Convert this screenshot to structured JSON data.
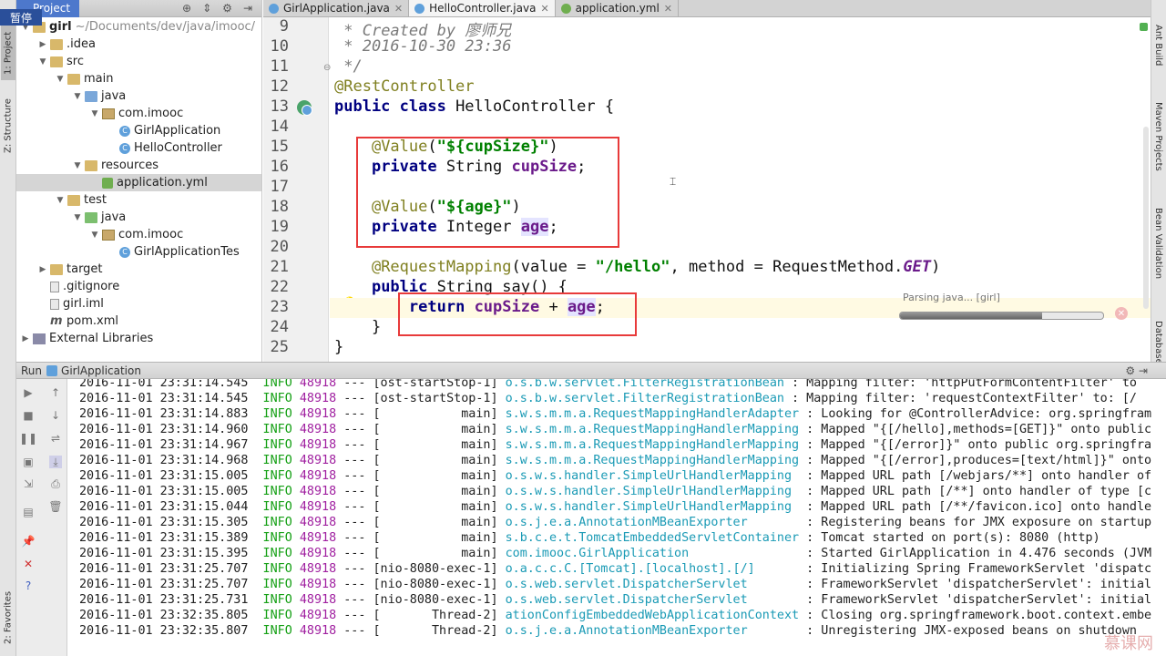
{
  "left_strip": {
    "tab1": "1: Project",
    "tab2": "Z: Structure",
    "tab3": "2: Favorites",
    "badge": "暂停"
  },
  "right_strip": {
    "tab1": "Ant Build",
    "tab2": "Maven Projects",
    "tab3": "Bean Validation",
    "tab4": "Database"
  },
  "project": {
    "title": "Project",
    "tree": [
      {
        "label": "girl",
        "extra": "~/Documents/dev/java/imooc/",
        "indent": 0,
        "arrow": "▼",
        "icon": "folder"
      },
      {
        "label": ".idea",
        "extra": "",
        "indent": 1,
        "arrow": "▶",
        "icon": "folder"
      },
      {
        "label": "src",
        "extra": "",
        "indent": 1,
        "arrow": "▼",
        "icon": "folder"
      },
      {
        "label": "main",
        "extra": "",
        "indent": 2,
        "arrow": "▼",
        "icon": "folder"
      },
      {
        "label": "java",
        "extra": "",
        "indent": 3,
        "arrow": "▼",
        "icon": "folder-blue"
      },
      {
        "label": "com.imooc",
        "extra": "",
        "indent": 4,
        "arrow": "▼",
        "icon": "package"
      },
      {
        "label": "GirlApplication",
        "extra": "",
        "indent": 5,
        "arrow": "",
        "icon": "class"
      },
      {
        "label": "HelloController",
        "extra": "",
        "indent": 5,
        "arrow": "",
        "icon": "class"
      },
      {
        "label": "resources",
        "extra": "",
        "indent": 3,
        "arrow": "▼",
        "icon": "folder"
      },
      {
        "label": "application.yml",
        "extra": "",
        "indent": 4,
        "arrow": "",
        "icon": "yml",
        "selected": true
      },
      {
        "label": "test",
        "extra": "",
        "indent": 2,
        "arrow": "▼",
        "icon": "folder"
      },
      {
        "label": "java",
        "extra": "",
        "indent": 3,
        "arrow": "▼",
        "icon": "folder-green"
      },
      {
        "label": "com.imooc",
        "extra": "",
        "indent": 4,
        "arrow": "▼",
        "icon": "package"
      },
      {
        "label": "GirlApplicationTes",
        "extra": "",
        "indent": 5,
        "arrow": "",
        "icon": "class"
      },
      {
        "label": "target",
        "extra": "",
        "indent": 1,
        "arrow": "▶",
        "icon": "folder"
      },
      {
        "label": ".gitignore",
        "extra": "",
        "indent": 1,
        "arrow": "",
        "icon": "file"
      },
      {
        "label": "girl.iml",
        "extra": "",
        "indent": 1,
        "arrow": "",
        "icon": "file"
      },
      {
        "label": "pom.xml",
        "extra": "",
        "indent": 1,
        "arrow": "",
        "icon": "m"
      },
      {
        "label": "External Libraries",
        "extra": "",
        "indent": 0,
        "arrow": "▶",
        "icon": "lib"
      }
    ]
  },
  "tabs": [
    {
      "label": "GirlApplication.java",
      "icon_color": "#5fa0db",
      "active": false
    },
    {
      "label": "HelloController.java",
      "icon_color": "#5fa0db",
      "active": true
    },
    {
      "label": "application.yml",
      "icon_color": "#6fae4f",
      "active": false
    }
  ],
  "editor": {
    "line_numbers": [
      "9",
      "10",
      "11",
      "12",
      "13",
      "14",
      "15",
      "16",
      "17",
      "18",
      "19",
      "20",
      "21",
      "22",
      "23",
      "24",
      "25"
    ],
    "lines": {
      "l9": "* Created by 廖师兄",
      "l10": "* 2016-10-30 23:36",
      "l11": "*/",
      "l12": "@RestController",
      "l13_kw": "public class",
      "l13_rest": " HelloController {",
      "l15_ann": "@Value",
      "l15_str": "\"${cupSize}\"",
      "l16_kw": "private",
      "l16_type": " String ",
      "l16_fld": "cupSize",
      "l18_ann": "@Value",
      "l18_str": "\"${age}\"",
      "l19_kw": "private",
      "l19_type": " Integer ",
      "l19_fld": "age",
      "l21_ann": "@RequestMapping",
      "l21_a": "(value = ",
      "l21_str": "\"/hello\"",
      "l21_b": ", method = RequestMethod.",
      "l21_get": "GET",
      "l21_c": ")",
      "l22_kw": "public",
      "l22_rest": " String say() {",
      "l23_kw": "return",
      "l23_f1": "cupSize",
      "l23_plus": " + ",
      "l23_f2": "age",
      "l23_end": ";",
      "l24": "}",
      "l25": "}"
    },
    "parse_status": "Parsing java... [girl]",
    "parse_progress": 0.7
  },
  "run": {
    "label": "Run",
    "config": "GirlApplication",
    "logs": [
      [
        "2016-11-01 23:31:14.545",
        "INFO",
        "48918",
        "---",
        "[ost-startStop-1]",
        "o.s.b.w.servlet.FilterRegistrationBean",
        ": Mapping filter: 'httpPutFormContentFilter' to"
      ],
      [
        "2016-11-01 23:31:14.545",
        "INFO",
        "48918",
        "---",
        "[ost-startStop-1]",
        "o.s.b.w.servlet.FilterRegistrationBean",
        ": Mapping filter: 'requestContextFilter' to: [/"
      ],
      [
        "2016-11-01 23:31:14.883",
        "INFO",
        "48918",
        "---",
        "[           main]",
        "s.w.s.m.m.a.RequestMappingHandlerAdapter",
        ": Looking for @ControllerAdvice: org.springfram"
      ],
      [
        "2016-11-01 23:31:14.960",
        "INFO",
        "48918",
        "---",
        "[           main]",
        "s.w.s.m.m.a.RequestMappingHandlerMapping",
        ": Mapped \"{[/hello],methods=[GET]}\" onto public"
      ],
      [
        "2016-11-01 23:31:14.967",
        "INFO",
        "48918",
        "---",
        "[           main]",
        "s.w.s.m.m.a.RequestMappingHandlerMapping",
        ": Mapped \"{[/error]}\" onto public org.springfra"
      ],
      [
        "2016-11-01 23:31:14.968",
        "INFO",
        "48918",
        "---",
        "[           main]",
        "s.w.s.m.m.a.RequestMappingHandlerMapping",
        ": Mapped \"{[/error],produces=[text/html]}\" onto"
      ],
      [
        "2016-11-01 23:31:15.005",
        "INFO",
        "48918",
        "---",
        "[           main]",
        "o.s.w.s.handler.SimpleUrlHandlerMapping ",
        ": Mapped URL path [/webjars/**] onto handler of"
      ],
      [
        "2016-11-01 23:31:15.005",
        "INFO",
        "48918",
        "---",
        "[           main]",
        "o.s.w.s.handler.SimpleUrlHandlerMapping ",
        ": Mapped URL path [/**] onto handler of type [c"
      ],
      [
        "2016-11-01 23:31:15.044",
        "INFO",
        "48918",
        "---",
        "[           main]",
        "o.s.w.s.handler.SimpleUrlHandlerMapping ",
        ": Mapped URL path [/**/favicon.ico] onto handle"
      ],
      [
        "2016-11-01 23:31:15.305",
        "INFO",
        "48918",
        "---",
        "[           main]",
        "o.s.j.e.a.AnnotationMBeanExporter       ",
        ": Registering beans for JMX exposure on startup"
      ],
      [
        "2016-11-01 23:31:15.389",
        "INFO",
        "48918",
        "---",
        "[           main]",
        "s.b.c.e.t.TomcatEmbeddedServletContainer",
        ": Tomcat started on port(s): 8080 (http)"
      ],
      [
        "2016-11-01 23:31:15.395",
        "INFO",
        "48918",
        "---",
        "[           main]",
        "com.imooc.GirlApplication               ",
        ": Started GirlApplication in 4.476 seconds (JVM"
      ],
      [
        "2016-11-01 23:31:25.707",
        "INFO",
        "48918",
        "---",
        "[nio-8080-exec-1]",
        "o.a.c.c.C.[Tomcat].[localhost].[/]      ",
        ": Initializing Spring FrameworkServlet 'dispatc"
      ],
      [
        "2016-11-01 23:31:25.707",
        "INFO",
        "48918",
        "---",
        "[nio-8080-exec-1]",
        "o.s.web.servlet.DispatcherServlet       ",
        ": FrameworkServlet 'dispatcherServlet': initial"
      ],
      [
        "2016-11-01 23:31:25.731",
        "INFO",
        "48918",
        "---",
        "[nio-8080-exec-1]",
        "o.s.web.servlet.DispatcherServlet       ",
        ": FrameworkServlet 'dispatcherServlet': initial"
      ],
      [
        "2016-11-01 23:32:35.805",
        "INFO",
        "48918",
        "---",
        "[       Thread-2]",
        "ationConfigEmbeddedWebApplicationContext",
        ": Closing org.springframework.boot.context.embe"
      ],
      [
        "2016-11-01 23:32:35.807",
        "INFO",
        "48918",
        "---",
        "[       Thread-2]",
        "o.s.j.e.a.AnnotationMBeanExporter       ",
        ": Unregistering JMX-exposed beans on shutdown"
      ]
    ]
  },
  "watermark": "慕课网"
}
